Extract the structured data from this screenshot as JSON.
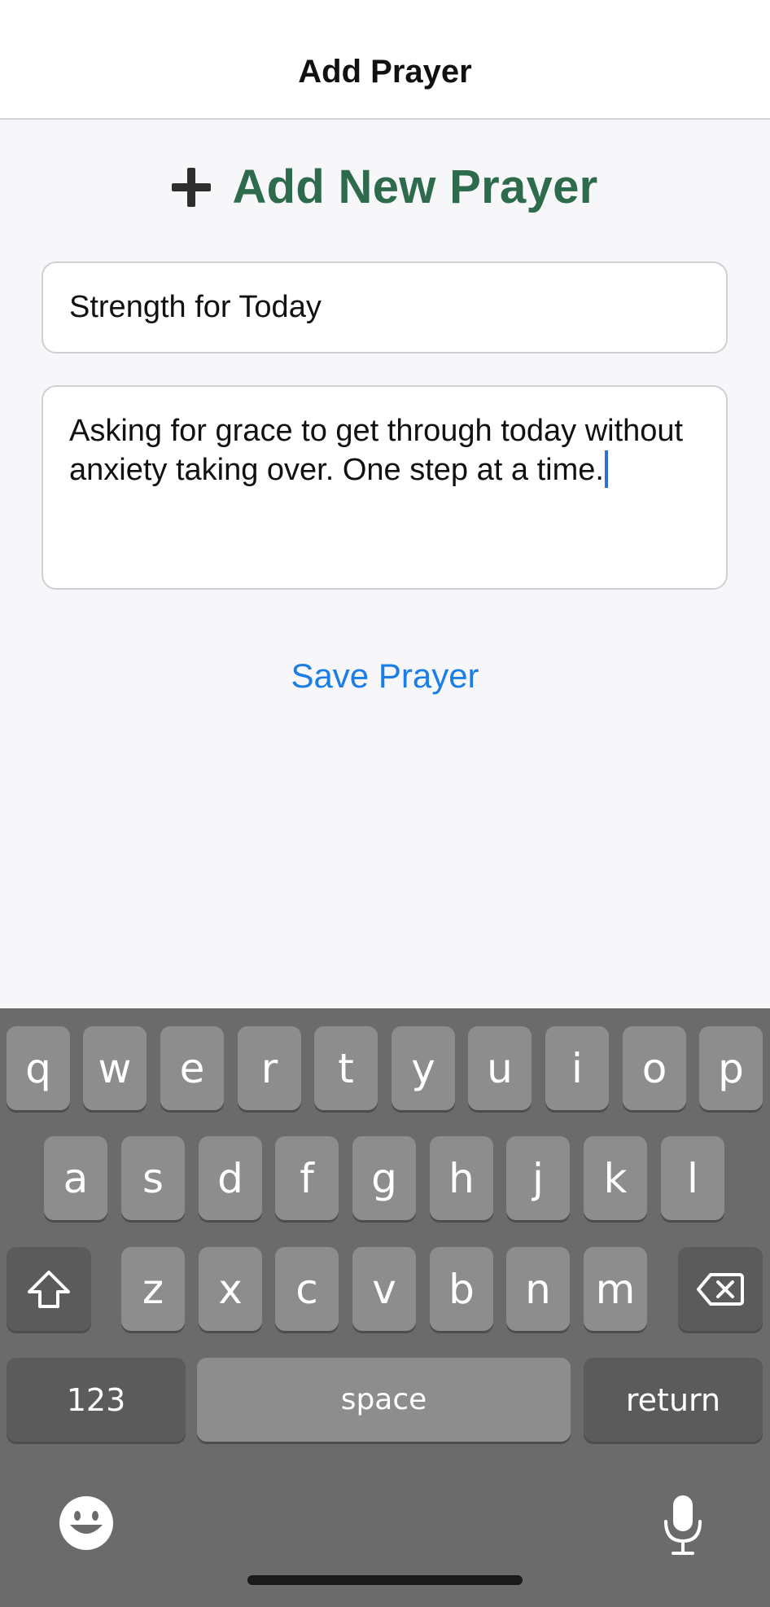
{
  "navbar": {
    "title": "Add Prayer"
  },
  "heading": {
    "icon": "plus-icon",
    "text": "Add New Prayer",
    "color": "#2e6b4c"
  },
  "form": {
    "title_value": "Strength for Today",
    "body_value": "Asking for grace to get through today without anxiety taking over. One step at a time."
  },
  "actions": {
    "save_label": "Save Prayer",
    "save_color": "#1a7ee6"
  },
  "keyboard": {
    "row1": [
      "q",
      "w",
      "e",
      "r",
      "t",
      "y",
      "u",
      "i",
      "o",
      "p"
    ],
    "row2": [
      "a",
      "s",
      "d",
      "f",
      "g",
      "h",
      "j",
      "k",
      "l"
    ],
    "row3": [
      "z",
      "x",
      "c",
      "v",
      "b",
      "n",
      "m"
    ],
    "numbers_label": "123",
    "space_label": "space",
    "return_label": "return",
    "icons": [
      "shift-icon",
      "backspace-icon",
      "emoji-icon",
      "microphone-icon"
    ]
  }
}
